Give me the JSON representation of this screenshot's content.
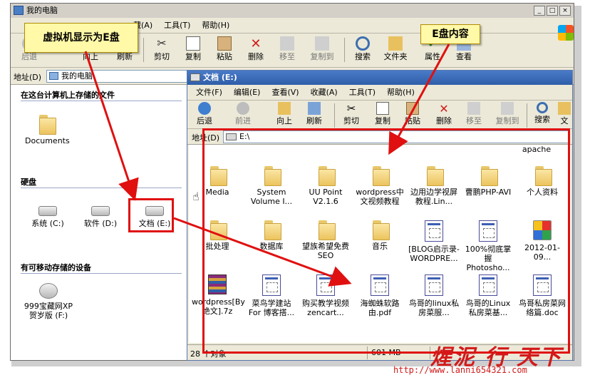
{
  "outer_window": {
    "title": "我的电脑",
    "menu": [
      "藏(A)",
      "工具(T)",
      "帮助(H)"
    ],
    "toolbar": [
      "后退",
      "向上",
      "刷新",
      "剪切",
      "复制",
      "粘贴",
      "删除",
      "移至",
      "复制到",
      "搜索",
      "文件夹",
      "属性",
      "查看"
    ],
    "address_label": "地址(D)",
    "address_value": "我的电脑"
  },
  "left_pane": {
    "section_files": "在这台计算机上存储的文件",
    "documents": "Documents",
    "section_drives": "硬盘",
    "drives": [
      "系统 (C:)",
      "软件 (D:)",
      "文档 (E:)"
    ],
    "section_removable": "有可移动存储的设备",
    "removable": [
      "999宝藏网XP",
      "贺岁版 (F:)"
    ]
  },
  "inner_window": {
    "title": "文档 (E:)",
    "menu": [
      "文件(F)",
      "编辑(E)",
      "查看(V)",
      "收藏(A)",
      "工具(T)",
      "帮助(H)"
    ],
    "toolbar": [
      "后退",
      "前进",
      "向上",
      "刷新",
      "剪切",
      "复制",
      "粘贴",
      "删除",
      "移至",
      "复制到",
      "搜索",
      "文"
    ],
    "address_label": "地址(D)",
    "address_value": "E:\\",
    "top_partial": [
      "apache"
    ],
    "items_row1": [
      {
        "label": "Media",
        "type": "folder"
      },
      {
        "label": "System Volume I...",
        "type": "folder"
      },
      {
        "label": "UU Point V2.1.6",
        "type": "folder"
      },
      {
        "label": "wordpress中文视频教程",
        "type": "folder"
      },
      {
        "label": "边用边学视屏教程.Lin...",
        "type": "folder"
      },
      {
        "label": "曹鹏PHP-AVI",
        "type": "folder"
      },
      {
        "label": "个人资料",
        "type": "folder"
      }
    ],
    "items_row2": [
      {
        "label": "批处理",
        "type": "folder"
      },
      {
        "label": "数据库",
        "type": "folder"
      },
      {
        "label": "望族希望免费SEO",
        "type": "folder"
      },
      {
        "label": "音乐",
        "type": "folder"
      },
      {
        "label": "[BLOG启示录-WORDPRE...",
        "type": "doc"
      },
      {
        "label": "100%彻底掌握Photosho...",
        "type": "doc"
      },
      {
        "label": "2012-01-09...",
        "type": "img"
      }
    ],
    "items_row3": [
      {
        "label": "wordpress[By 绝文].7z",
        "type": "rar"
      },
      {
        "label": "菜鸟学建站For 博客搭...",
        "type": "doc"
      },
      {
        "label": "购买教学视频zencart...",
        "type": "doc"
      },
      {
        "label": "海蜘蛛软路由.pdf",
        "type": "doc"
      },
      {
        "label": "鸟哥的linux私房菜服...",
        "type": "doc"
      },
      {
        "label": "鸟哥的Linux私房菜基...",
        "type": "doc"
      },
      {
        "label": "鸟哥私房菜网络篇.doc",
        "type": "doc"
      }
    ],
    "status_count": "28 个对象",
    "status_size": "601 MB"
  },
  "callouts": {
    "left": "虚拟机显示为E盘",
    "right": "E盘内容"
  },
  "watermark": {
    "text": "煋泥 行 天下",
    "url": "http://www.lanni654321.com"
  },
  "colors": {
    "callout_bg": "#fff9a8",
    "highlight_red": "#e01010",
    "title_blue": "#2f5ea8"
  }
}
